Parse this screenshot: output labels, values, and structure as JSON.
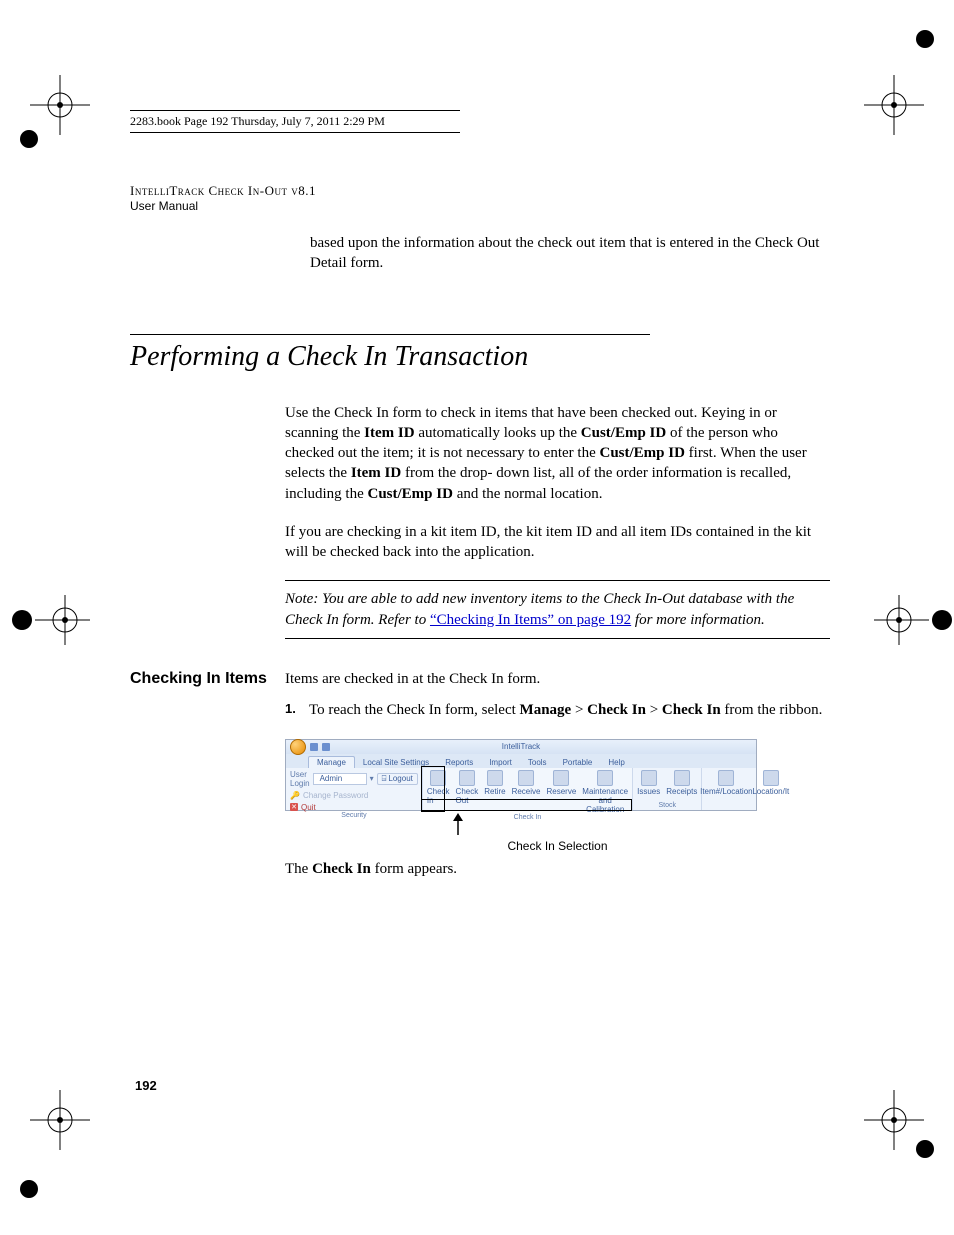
{
  "book_header": "2283.book  Page 192  Thursday, July 7, 2011  2:29 PM",
  "running_head": {
    "line1": "IntelliTrack Check In-Out v8.1",
    "line2": "User Manual"
  },
  "intro": "based upon the information about the check out item that is entered in the Check Out Detail form.",
  "section_title": "Performing a Check In Transaction",
  "para1_a": "Use the Check In form to check in items that have been checked out. Keying in or scanning the ",
  "para1_b": "Item ID",
  "para1_c": " automatically looks up the ",
  "para1_d": "Cust/Emp ID",
  "para1_e": " of the person who checked out the item; it is not necessary to enter the ",
  "para1_f": "Cust/Emp ID",
  "para1_g": " first. When the user selects the ",
  "para1_h": "Item ID",
  "para1_i": " from the drop- down list, all of the order information is recalled, including the ",
  "para1_j": "Cust/Emp ID",
  "para1_k": " and the normal location.",
  "para2": "If you are checking in a kit item ID, the kit item ID and all item IDs contained in the kit will be checked back  into the application.",
  "note_a": "Note:   You are able to add new inventory items to the Check In-Out database with the Check In form. Refer to ",
  "note_link": "“Checking In Items” on page 192",
  "note_b": " for more information.",
  "side_head": "Checking In Items",
  "lead": "Items are checked in at the Check In form.",
  "step1_a": "To reach the Check In form, select ",
  "step1_b": "Manage",
  "step1_c": " > ",
  "step1_d": "Check In ",
  "step1_e": " > ",
  "step1_f": "Check In",
  "step1_g": " from the ribbon.",
  "ribbon": {
    "app_title": "IntelliTrack",
    "tabs": [
      "Manage",
      "Local Site Settings",
      "Reports",
      "Import",
      "Tools",
      "Portable",
      "Help"
    ],
    "security": {
      "user_login_label": "User Login",
      "user_login_value": "Admin",
      "logout": "Logout",
      "change_password": "Change Password",
      "quit": "Quit",
      "group_title": "Security"
    },
    "checkin_group": {
      "buttons": [
        "Check In",
        "Check Out",
        "Retire",
        "Receive",
        "Reserve",
        "Maintenance and Calibration"
      ],
      "group_title": "Check In"
    },
    "stock_group": {
      "buttons": [
        "Issues",
        "Receipts"
      ],
      "group_title": "Stock"
    },
    "last_group": {
      "buttons": [
        "Item#/Location",
        "Location/It"
      ]
    }
  },
  "caption": "Check In Selection",
  "after_figure_a": "The ",
  "after_figure_b": "Check In",
  "after_figure_c": " form appears.",
  "page_num": "192"
}
